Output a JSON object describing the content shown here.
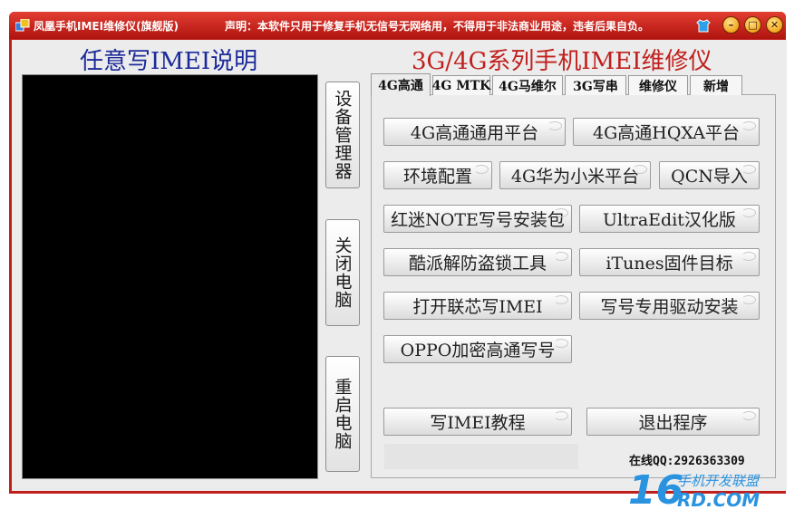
{
  "window": {
    "title": "凤凰手机IMEI维修仪(旗舰版)",
    "notice": "声明：本软件只用于修复手机无信号无网络用，不得用于非法商业用途，违者后果自负。",
    "controls": {
      "minimize": "–",
      "maximize": "□",
      "close": "✕"
    }
  },
  "left_panel": {
    "title": "任意写IMEI说明"
  },
  "side_buttons": [
    {
      "label": "设备管理器"
    },
    {
      "label": "关闭电脑"
    },
    {
      "label": "重启电脑"
    }
  ],
  "main": {
    "title": "3G/4G系列手机IMEI维修仪",
    "tabs": [
      {
        "label": "4G高通",
        "active": true
      },
      {
        "label": "4G MTK",
        "active": false
      },
      {
        "label": "4G马维尔",
        "active": false
      },
      {
        "label": "3G写串",
        "active": false
      },
      {
        "label": "维修仪",
        "active": false
      },
      {
        "label": "新增",
        "active": false
      }
    ],
    "buttons": [
      {
        "label": "4G高通通用平台"
      },
      {
        "label": "4G高通HQXA平台"
      },
      {
        "label": "环境配置"
      },
      {
        "label": "4G华为小米平台"
      },
      {
        "label": "QCN导入"
      },
      {
        "label": "红迷NOTE写号安装包"
      },
      {
        "label": "UltraEdit汉化版"
      },
      {
        "label": "酷派解防盗锁工具"
      },
      {
        "label": "iTunes固件目标"
      },
      {
        "label": "打开联芯写IMEI"
      },
      {
        "label": "写号专用驱动安装"
      },
      {
        "label": "OPPO加密高通写号"
      },
      {
        "label": "写IMEI教程"
      },
      {
        "label": "退出程序"
      }
    ]
  },
  "footer": {
    "online_qq": "在线QQ:2926363309"
  },
  "watermark": {
    "big": "16",
    "top": "手机开发联盟",
    "bottom": "RD.COM"
  },
  "colors": {
    "frame": "#c0201d",
    "left_title": "#1c2a99",
    "right_title": "#c0201d",
    "watermark": "#2a93e0"
  }
}
